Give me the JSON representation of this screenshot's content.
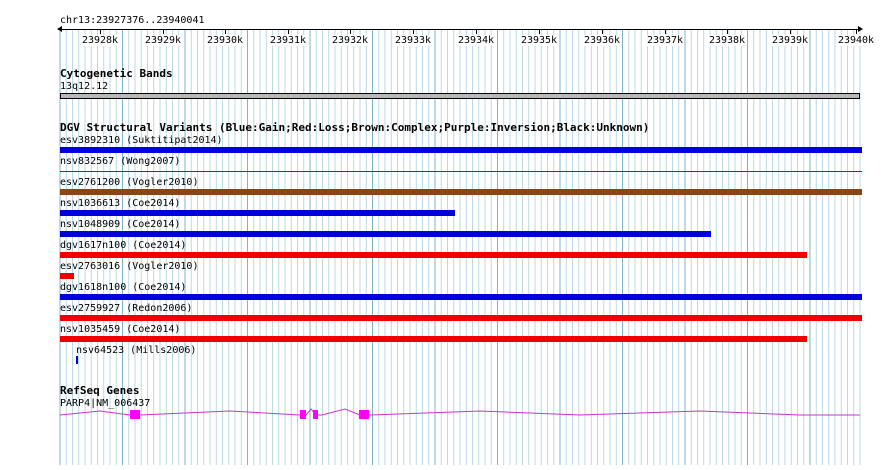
{
  "locus": "chr13:23927376..23940041",
  "ruler": {
    "ticks": [
      "23928k",
      "23929k",
      "23930k",
      "23931k",
      "23932k",
      "23933k",
      "23934k",
      "23935k",
      "23936k",
      "23937k",
      "23938k",
      "23939k",
      "23940k"
    ]
  },
  "cytoband": {
    "title": "Cytogenetic Bands",
    "band": "13q12.12"
  },
  "dgv": {
    "title": "DGV Structural Variants (Blue:Gain;Red:Loss;Brown:Complex;Purple:Inversion;Black:Unknown)",
    "colors": {
      "gain": "#0000dd",
      "loss": "#ee0000",
      "complex": "#8b4513",
      "loss_thin": "#cc0000"
    },
    "variants": [
      {
        "label": "esv3892310 (Suktitipat2014)",
        "type": "gain"
      },
      {
        "label": "nsv832567 (Wong2007)",
        "type": "loss_thin"
      },
      {
        "label": "esv2761200 (Vogler2010)",
        "type": "complex"
      },
      {
        "label": "nsv1036613 (Coe2014)",
        "type": "gain"
      },
      {
        "label": "nsv1048909 (Coe2014)",
        "type": "gain"
      },
      {
        "label": "dgv1617n100 (Coe2014)",
        "type": "loss"
      },
      {
        "label": "esv2763016 (Vogler2010)",
        "type": "loss"
      },
      {
        "label": "dgv1618n100 (Coe2014)",
        "type": "gain"
      },
      {
        "label": "esv2759927 (Redon2006)",
        "type": "loss"
      },
      {
        "label": "nsv1035459 (Coe2014)",
        "type": "loss"
      },
      {
        "label": "nsv64523 (Mills2006)",
        "type": "gain"
      }
    ]
  },
  "refseq": {
    "title": "RefSeq Genes",
    "gene": "PARP4|NM_006437",
    "color": "#ff00ff",
    "line_color": "#cc33cc"
  }
}
